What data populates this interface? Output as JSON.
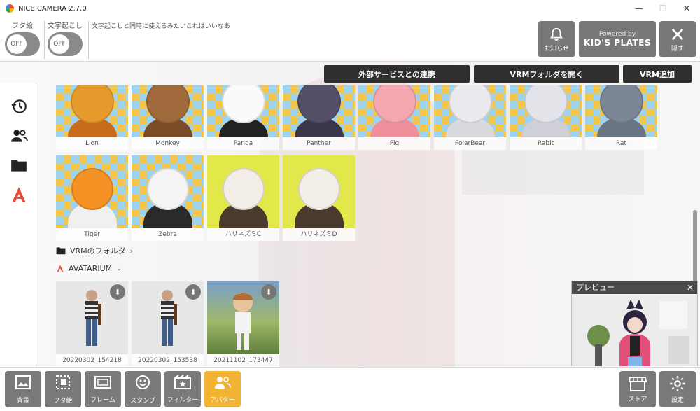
{
  "window": {
    "title": "NICE CAMERA 2.7.0",
    "minimize": "—",
    "maximize": "☐",
    "close": "✕"
  },
  "toggles": [
    {
      "label": "フタ絵",
      "state": "OFF"
    },
    {
      "label": "文字起こし",
      "state": "OFF"
    }
  ],
  "caption_text": "文字起こしと同時に使えるみたいこれはいいなあ",
  "top_buttons": {
    "notice": "お知らせ",
    "kids_powered": "Powered by",
    "kids_name": "KID'S PLATES",
    "hide": "隠す"
  },
  "actions": {
    "external": "外部サービスとの連携",
    "open_folder": "VRMフォルダを開く",
    "add_vrm": "VRM追加"
  },
  "animals": [
    {
      "name": "Lion",
      "head": "#e79a2c",
      "body": "#c76c1a"
    },
    {
      "name": "Monkey",
      "head": "#a06a3c",
      "body": "#7a4b26"
    },
    {
      "name": "Panda",
      "head": "#fafafa",
      "body": "#222222"
    },
    {
      "name": "Panther",
      "head": "#55506a",
      "body": "#3a364a"
    },
    {
      "name": "Pig",
      "head": "#f4a7b0",
      "body": "#ee8f9b"
    },
    {
      "name": "PolarBear",
      "head": "#e9e9ee",
      "body": "#d9d9e0"
    },
    {
      "name": "Rabit",
      "head": "#e3e3ea",
      "body": "#cfcfd8"
    },
    {
      "name": "Rat",
      "head": "#7c8796",
      "body": "#6a7584"
    },
    {
      "name": "Tiger",
      "head": "#f39124",
      "body": "#f0f0f0"
    },
    {
      "name": "Zebra",
      "head": "#f4f4f4",
      "body": "#2a2a2a"
    },
    {
      "name": "ハリネズミC",
      "head": "#f3ede8",
      "body": "#4a3b2e"
    },
    {
      "name": "ハリネズミD",
      "head": "#f3ede8",
      "body": "#4a3b2e"
    }
  ],
  "sections": {
    "vrm_folder": "VRMのフォルダ",
    "avatarium": "AVATARIUM"
  },
  "avatars": [
    {
      "name": "20220302_154218"
    },
    {
      "name": "20220302_153538"
    },
    {
      "name": "20211102_173447"
    }
  ],
  "preview": {
    "title": "プレビュー",
    "close": "✕"
  },
  "bottom_tabs": [
    {
      "label": "背景",
      "active": false
    },
    {
      "label": "フタ絵",
      "active": false
    },
    {
      "label": "フレーム",
      "active": false
    },
    {
      "label": "スタンプ",
      "active": false
    },
    {
      "label": "フィルター",
      "active": false
    },
    {
      "label": "アバター",
      "active": true
    }
  ],
  "bottom_right": {
    "store": "ストア",
    "settings": "設定"
  },
  "colors": {
    "accent": "#f2b233",
    "button": "#7a7a7a",
    "action": "#2f2f2f",
    "avatarium": "#e84c3d"
  }
}
